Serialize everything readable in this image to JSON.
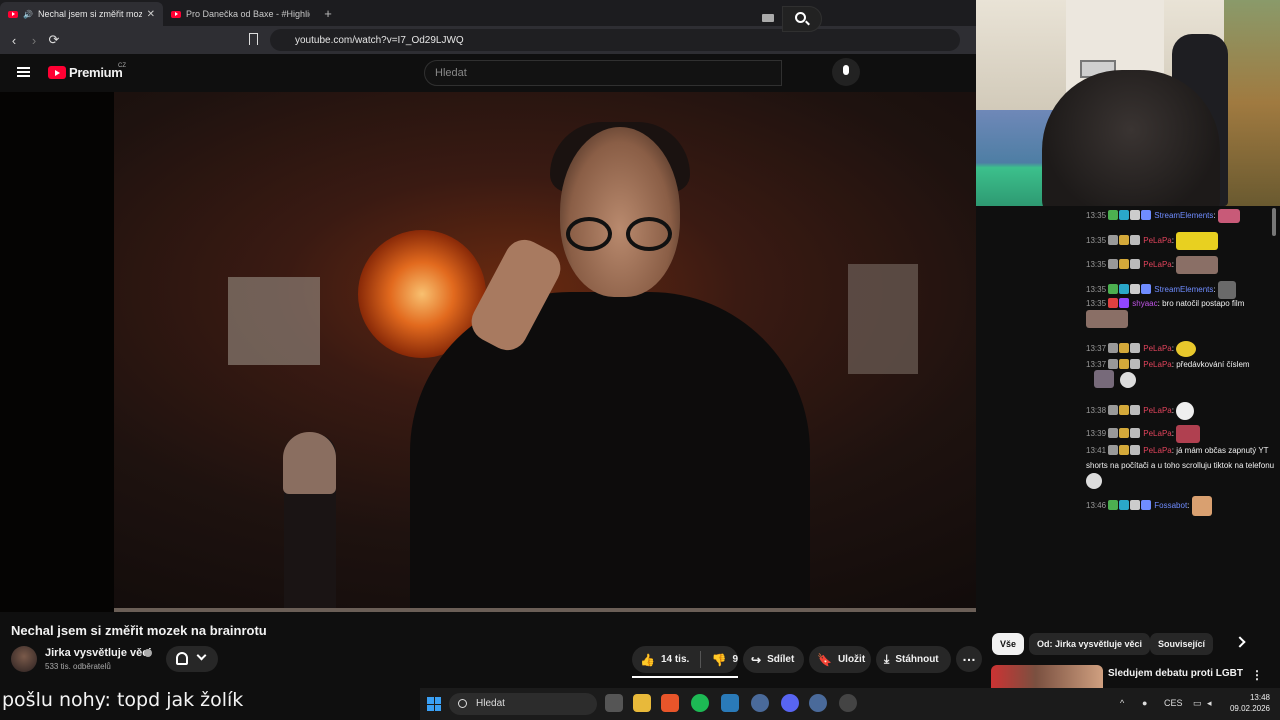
{
  "browser": {
    "tabs": [
      {
        "title": "Nechal jsem si změřit mozek",
        "active": true
      },
      {
        "title": "Pro Danečka od Baxe - #Highlights",
        "active": false
      }
    ],
    "url": "youtube.com/watch?v=I7_Od29LJWQ"
  },
  "youtube": {
    "logo": "Premium",
    "logo_country": "CZ",
    "search_placeholder": "Hledat",
    "video_title": "Nechal jsem si změřit mozek na brainrotu",
    "channel_name": "Jirka vysvětluje věci",
    "subscribers": "533 tis. odběratelů",
    "likes": "14 tis.",
    "dislikes": "9",
    "share_label": "Sdílet",
    "save_label": "Uložit",
    "download_label": "Stáhnout",
    "chips": [
      "Vše",
      "Od: Jirka vysvětluje věci",
      "Související"
    ],
    "recommended_title": "Sledujem debatu proti LGBT"
  },
  "chat": {
    "messages": [
      {
        "time": "13:35",
        "user": "StreamElements",
        "color": "#6f8cff",
        "text": ""
      },
      {
        "time": "13:35",
        "user": "PeLaPa",
        "color": "#e0435b",
        "text": ""
      },
      {
        "time": "13:35",
        "user": "PeLaPa",
        "color": "#e0435b",
        "text": ""
      },
      {
        "time": "13:35",
        "user": "StreamElements",
        "color": "#6f8cff",
        "text": ""
      },
      {
        "time": "13:35",
        "user": "shyaac",
        "color": "#c054e8",
        "text": "bro natočil postapo film"
      },
      {
        "time": "13:37",
        "user": "PeLaPa",
        "color": "#e0435b",
        "text": ""
      },
      {
        "time": "13:37",
        "user": "PeLaPa",
        "color": "#e0435b",
        "text": "předávkování číslem"
      },
      {
        "time": "13:38",
        "user": "PeLaPa",
        "color": "#e0435b",
        "text": ""
      },
      {
        "time": "13:39",
        "user": "PeLaPa",
        "color": "#e0435b",
        "text": ""
      },
      {
        "time": "13:41",
        "user": "PeLaPa",
        "color": "#e0435b",
        "text": "já mám občas zapnutý YT shorts na počítači a u toho scrolluju tiktok na telefonu"
      },
      {
        "time": "13:46",
        "user": "Fossabot",
        "color": "#6f8cff",
        "text": ""
      }
    ]
  },
  "caption": "pošlu nohy: topd jak žolík",
  "taskbar": {
    "search_placeholder": "Hledat",
    "language": "CES",
    "time": "13:48",
    "date": "09.02.2026"
  },
  "colors": {
    "youtube_red": "#ff0033",
    "background": "#0f0f0f",
    "chip_bg": "#272727"
  }
}
